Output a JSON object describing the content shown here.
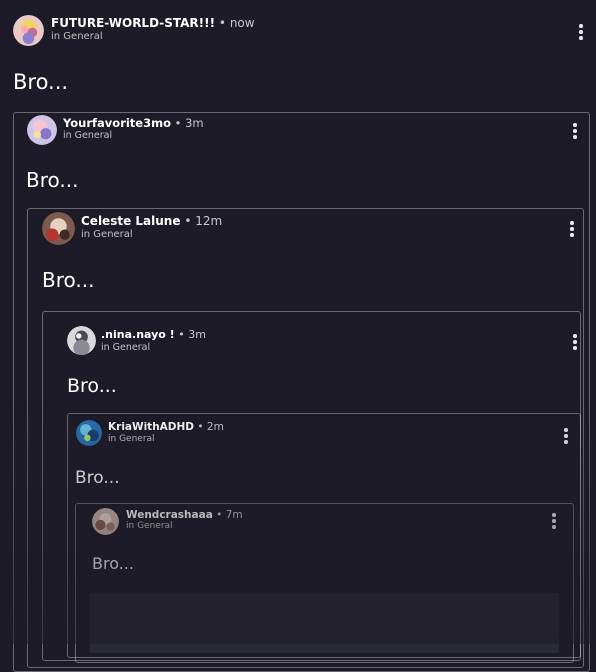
{
  "posts": [
    {
      "author": "FUTURE-WORLD-STAR!!!",
      "time": "now",
      "channel": "in General",
      "text": "Bro..."
    },
    {
      "author": "Yourfavorite3mo",
      "time": "3m",
      "channel": "in General",
      "text": "Bro..."
    },
    {
      "author": "Celeste Lalune",
      "time": "12m",
      "channel": "in General",
      "text": "Bro..."
    },
    {
      "author": ".nina.nayo !",
      "time": "3m",
      "channel": "in General",
      "text": "Bro..."
    },
    {
      "author": "KriaWithADHD",
      "time": "2m",
      "channel": "in General",
      "text": "Bro..."
    },
    {
      "author": "Wendcrashaaa",
      "time": "7m",
      "channel": "in General",
      "text": "Bro..."
    }
  ],
  "separator": "•",
  "icons": {
    "avatar": "user-avatar",
    "menu": "more-vertical-icon"
  },
  "colors": {
    "background": "#1c1b27",
    "border": "#6f6e78",
    "text": "#ffffff"
  }
}
